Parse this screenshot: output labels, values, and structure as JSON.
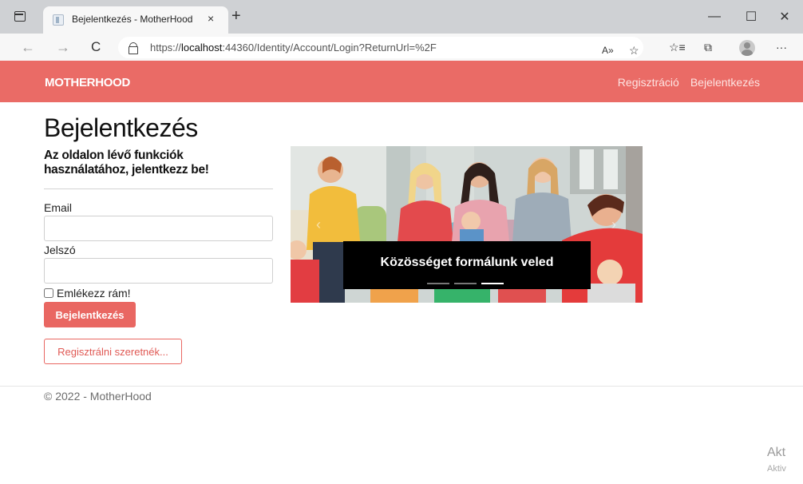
{
  "browser": {
    "tab_title": "Bejelentkezés - MotherHood",
    "tab_close": "×",
    "new_tab": "+",
    "url_prefix": "https://",
    "url_host": "localhost",
    "url_rest": ":44360/Identity/Account/Login?ReturnUrl=%2F",
    "window_minimize": "—",
    "window_maximize": "☐",
    "window_close": "✕",
    "back": "←",
    "forward": "→",
    "reload": "C",
    "read_aloud": "A»",
    "favorite": "☆",
    "favorites_bar": "☆≡",
    "collections": "⧉",
    "more": "···"
  },
  "navbar": {
    "brand": "MOTHERHOOD",
    "links": [
      "Regisztráció",
      "Bejelentkezés"
    ],
    "bg_color": "#ea6b66"
  },
  "login": {
    "title": "Bejelentkezés",
    "subtitle": "Az oldalon lévő funkciók használatához, jelentkezz be!",
    "email_label": "Email",
    "email_value": "",
    "password_label": "Jelszó",
    "password_value": "",
    "remember_label": "Emlékezz rám!",
    "submit_label": "Bejelentkezés",
    "register_label": "Regisztrálni szeretnék..."
  },
  "carousel": {
    "caption": "Közösséget formálunk veled",
    "slide_count": 3,
    "active_slide": 3,
    "prev_arrow": "‹",
    "next_arrow": "›"
  },
  "footer": {
    "text": "© 2022 - MotherHood"
  },
  "overlay": {
    "line1": "Akt",
    "line2": "Aktiv"
  }
}
